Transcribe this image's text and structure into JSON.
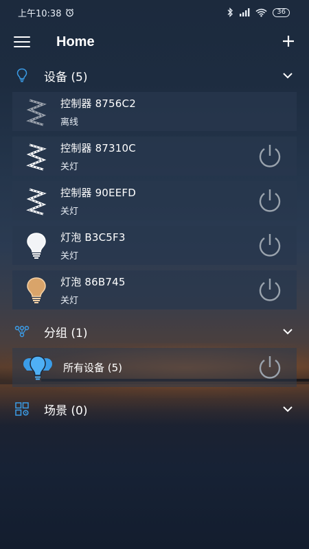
{
  "status_bar": {
    "time": "上午10:38",
    "battery": "36"
  },
  "top_bar": {
    "title": "Home",
    "menu_icon": "hamburger-menu-icon",
    "add_icon": "plus-icon"
  },
  "sections": {
    "devices": {
      "title": "设备 (5)",
      "icon": "lightbulb-outline-icon",
      "items": [
        {
          "name": "控制器  8756C2",
          "state": "离线",
          "icon": "led-strip-icon",
          "has_power": false
        },
        {
          "name": "控制器  87310C",
          "state": "关灯",
          "icon": "led-strip-icon",
          "has_power": true
        },
        {
          "name": "控制器  90EEFD",
          "state": "关灯",
          "icon": "led-strip-icon",
          "has_power": true
        },
        {
          "name": "灯泡  B3C5F3",
          "state": "关灯",
          "icon": "white-bulb-icon",
          "has_power": true
        },
        {
          "name": "灯泡  86B745",
          "state": "关灯",
          "icon": "warm-bulb-icon",
          "has_power": true
        }
      ]
    },
    "groups": {
      "title": "分组 (1)",
      "icon": "group-network-icon",
      "items": [
        {
          "name": "所有设备 (5)",
          "icon": "multi-bulb-icon"
        }
      ]
    },
    "scenes": {
      "title": "场景 (0)",
      "icon": "scene-grid-icon"
    }
  },
  "colors": {
    "accent_blue": "#3b9de8",
    "card_bg": "#28384e",
    "warm_bulb": "#d9a46a"
  }
}
